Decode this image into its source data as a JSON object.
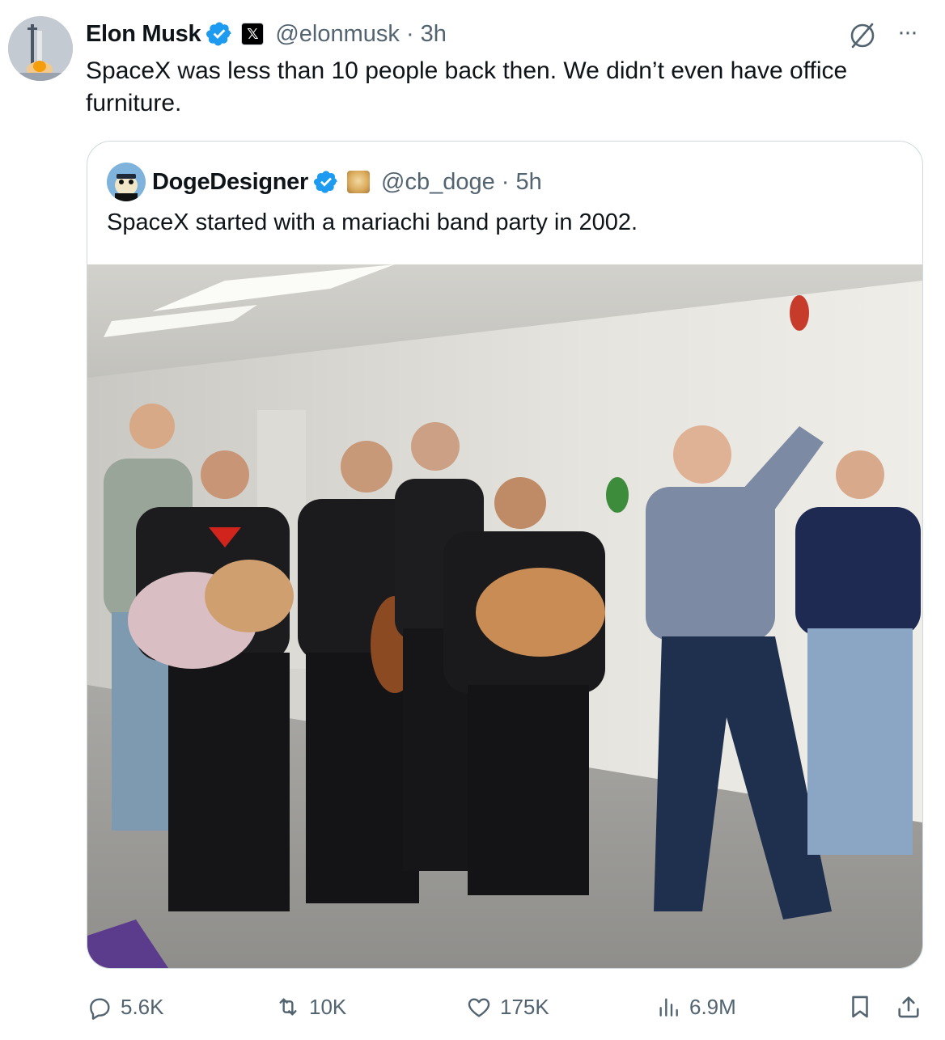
{
  "post": {
    "author_name": "Elon Musk",
    "handle": "@elonmusk",
    "time": "3h",
    "text": "SpaceX was less than 10 people back then. We didn’t even have office furniture.",
    "affiliate_badge": "x-logo-icon"
  },
  "quoted": {
    "author_name": "DogeDesigner",
    "handle": "@cb_doge",
    "time": "5h",
    "text": "SpaceX started with a mariachi band party in 2002.",
    "affiliate_badge": "doge-avatar-icon"
  },
  "actions": {
    "replies": "5.6K",
    "reposts": "10K",
    "likes": "175K",
    "views": "6.9M"
  },
  "colors": {
    "verified": "#1d9bf0",
    "secondary_text": "#536471",
    "border": "#cfd9de"
  }
}
